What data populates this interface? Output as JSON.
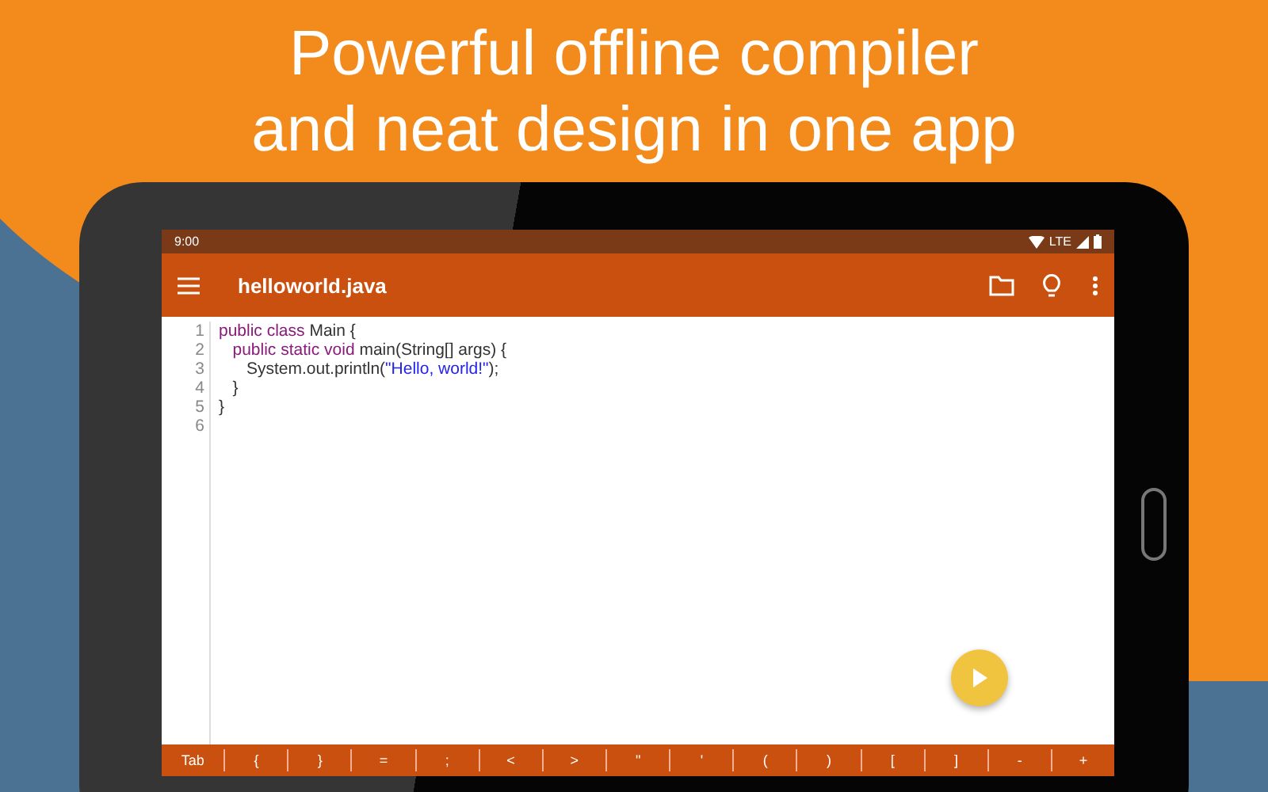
{
  "headline": [
    "Powerful offline compiler",
    "and neat design in one app"
  ],
  "status_bar": {
    "time": "9:00",
    "network": "LTE"
  },
  "toolbar": {
    "title": "helloworld.java"
  },
  "editor": {
    "lines": [
      {
        "number": "1",
        "tokens": [
          {
            "text": "public class ",
            "kind": "keyword"
          },
          {
            "text": "Main {",
            "kind": "plain"
          }
        ]
      },
      {
        "number": "2",
        "tokens": [
          {
            "text": "   public static void ",
            "kind": "keyword"
          },
          {
            "text": "main(String[] args) {",
            "kind": "plain"
          }
        ]
      },
      {
        "number": "3",
        "tokens": [
          {
            "text": "      System.out.println(",
            "kind": "plain"
          },
          {
            "text": "\"Hello, world!\"",
            "kind": "string"
          },
          {
            "text": ");",
            "kind": "plain"
          }
        ]
      },
      {
        "number": "4",
        "tokens": [
          {
            "text": "   }",
            "kind": "plain"
          }
        ]
      },
      {
        "number": "5",
        "tokens": [
          {
            "text": "}",
            "kind": "plain"
          }
        ]
      },
      {
        "number": "6"
      }
    ]
  },
  "keys": [
    "Tab",
    "{",
    "}",
    "=",
    ";",
    "<",
    ">",
    "\"",
    "'",
    "(",
    ")",
    "[",
    "]",
    "-",
    "+"
  ]
}
